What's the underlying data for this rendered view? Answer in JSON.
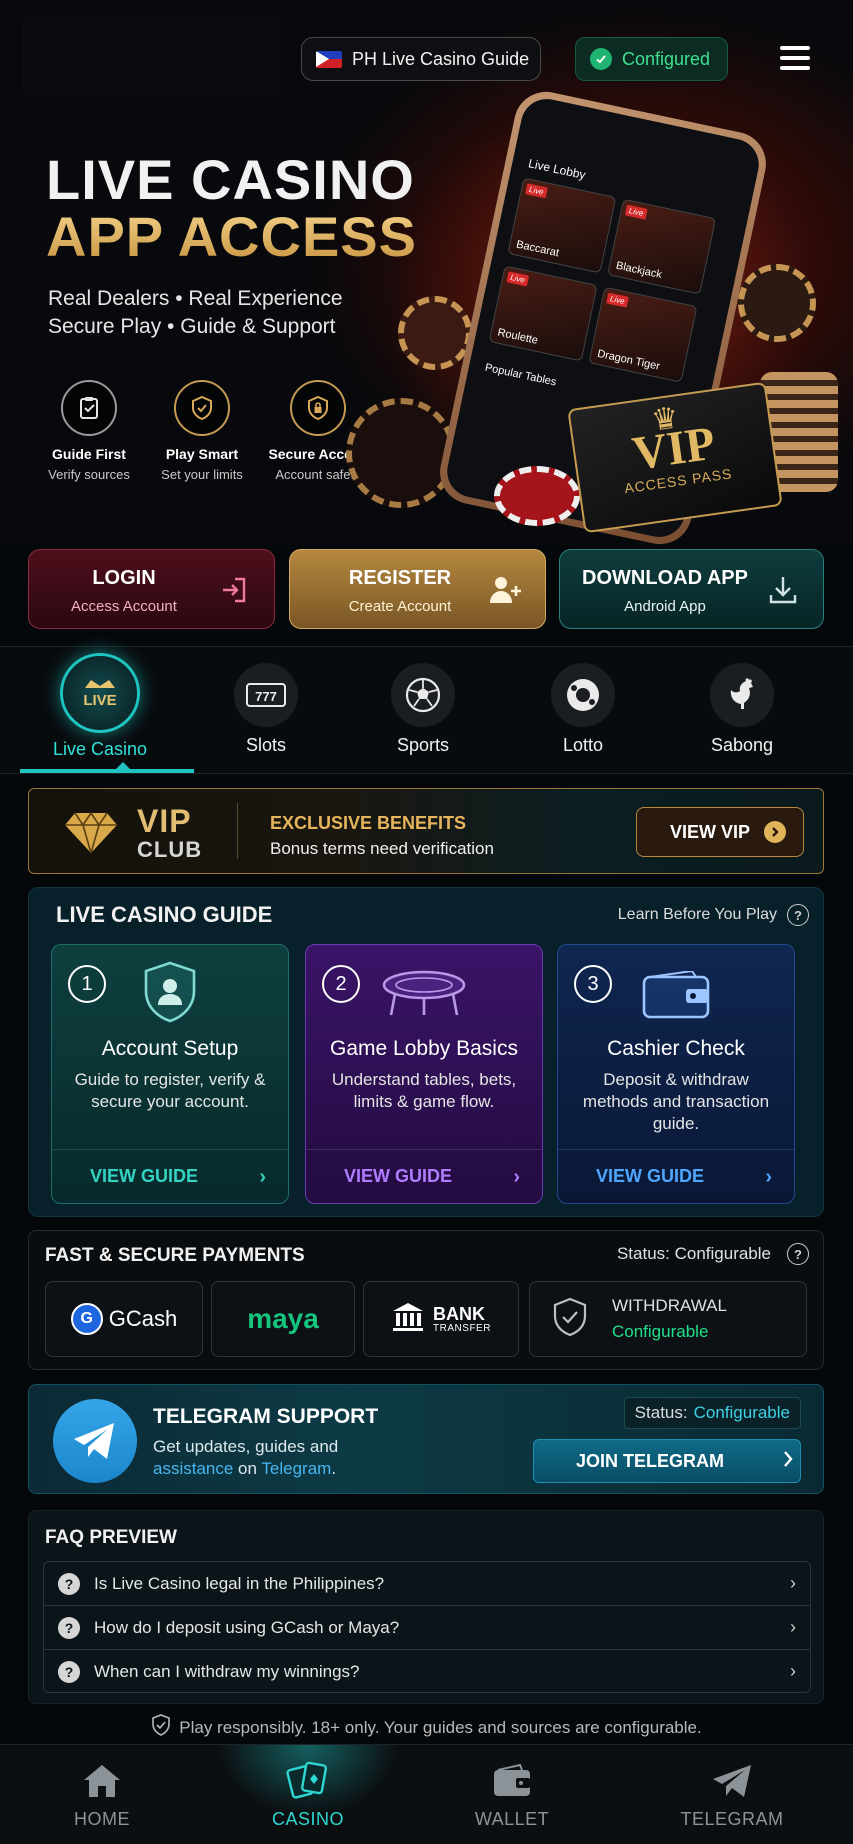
{
  "header": {
    "guide_pill": "PH Live Casino Guide",
    "status_pill": "Configured"
  },
  "hero": {
    "title_line1": "LIVE CASINO",
    "title_line2": "APP ACCESS",
    "subtitle_line1": "Real Dealers  •  Real Experience",
    "subtitle_line2": "Secure Play  •  Guide & Support",
    "features": [
      {
        "title": "Guide First",
        "sub": "Verify sources",
        "icon": "clipboard-check-icon"
      },
      {
        "title": "Play Smart",
        "sub": "Set your limits",
        "icon": "shield-check-icon"
      },
      {
        "title": "Secure Access",
        "sub": "Account safety",
        "icon": "shield-lock-icon"
      }
    ],
    "phone": {
      "lobby_label": "Live Lobby",
      "tiles": [
        "Baccarat",
        "Blackjack",
        "Roulette",
        "Dragon Tiger"
      ],
      "live_badge": "Live",
      "popular_label": "Popular Tables"
    },
    "vip_card": {
      "title": "VIP",
      "sub": "ACCESS PASS"
    }
  },
  "actions": [
    {
      "title": "LOGIN",
      "sub": "Access Account",
      "icon": "login-icon"
    },
    {
      "title": "REGISTER",
      "sub": "Create Account",
      "icon": "add-user-icon"
    },
    {
      "title": "DOWNLOAD APP",
      "sub": "Android App",
      "icon": "download-icon"
    }
  ],
  "categories": [
    {
      "label": "Live Casino",
      "badge": "LIVE",
      "active": true
    },
    {
      "label": "Slots",
      "badge": "777"
    },
    {
      "label": "Sports"
    },
    {
      "label": "Lotto"
    },
    {
      "label": "Sabong"
    }
  ],
  "vip_banner": {
    "title": "VIP",
    "sub": "CLUB",
    "headline": "EXCLUSIVE BENEFITS",
    "desc": "Bonus terms need verification",
    "button": "VIEW VIP"
  },
  "guide": {
    "heading": "LIVE CASINO GUIDE",
    "learn": "Learn Before You Play",
    "cards": [
      {
        "num": "1",
        "title": "Account Setup",
        "desc": "Guide to register, verify & secure your account.",
        "cta": "VIEW GUIDE"
      },
      {
        "num": "2",
        "title": "Game Lobby Basics",
        "desc": "Understand tables, bets, limits & game flow.",
        "cta": "VIEW GUIDE"
      },
      {
        "num": "3",
        "title": "Cashier Check",
        "desc": "Deposit & withdraw methods and transaction guide.",
        "cta": "VIEW GUIDE"
      }
    ]
  },
  "payments": {
    "heading": "FAST & SECURE PAYMENTS",
    "status": "Status: Configurable",
    "gcash": "GCash",
    "gcash_mark": "G",
    "maya": "maya",
    "bank": "BANK",
    "bank_sub": "TRANSFER",
    "withdrawal": "WITHDRAWAL",
    "withdrawal_status": "Configurable"
  },
  "telegram": {
    "heading": "TELEGRAM SUPPORT",
    "desc_line1": "Get updates, guides and",
    "desc_line2_a": "assistance",
    "desc_line2_b": " on ",
    "desc_line2_c": "Telegram",
    "desc_line2_d": ".",
    "status_label": "Status:",
    "status_value": "Configurable",
    "button": "JOIN TELEGRAM"
  },
  "faq": {
    "heading": "FAQ PREVIEW",
    "items": [
      "Is Live Casino legal in the Philippines?",
      "How do I deposit using GCash or Maya?",
      "When can I withdraw my winnings?"
    ]
  },
  "disclaimer": "Play responsibly. 18+ only. Your guides and sources are configurable.",
  "bottom_nav": [
    {
      "label": "HOME"
    },
    {
      "label": "CASINO",
      "active": true
    },
    {
      "label": "WALLET"
    },
    {
      "label": "TELEGRAM"
    }
  ],
  "colors": {
    "accent_teal": "#1fc3bf",
    "gold": "#e1b863",
    "configured_green": "#3fe08f"
  }
}
